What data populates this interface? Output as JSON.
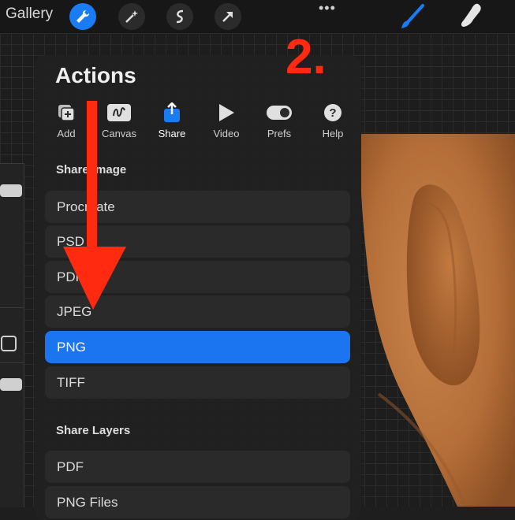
{
  "toolbar": {
    "gallery_label": "Gallery",
    "tools": [
      "wrench-icon",
      "magic-wand-icon",
      "selection-icon",
      "transform-arrow-icon"
    ],
    "more_label": "•••",
    "right_tools": [
      "brush-icon",
      "smudge-icon"
    ],
    "accent": "#1a7cf5"
  },
  "annotation": {
    "step_label": "2.",
    "arrow_color": "#ff2a10"
  },
  "actions_panel": {
    "title": "Actions",
    "tabs": [
      {
        "label": "Add",
        "icon": "add-image-icon"
      },
      {
        "label": "Canvas",
        "icon": "canvas-icon"
      },
      {
        "label": "Share",
        "icon": "share-icon",
        "selected": true
      },
      {
        "label": "Video",
        "icon": "play-icon"
      },
      {
        "label": "Prefs",
        "icon": "toggle-icon"
      },
      {
        "label": "Help",
        "icon": "help-icon"
      }
    ],
    "share_image": {
      "heading": "Share Image",
      "items": [
        "Procreate",
        "PSD",
        "PDF",
        "JPEG",
        "PNG",
        "TIFF"
      ],
      "selected": "PNG"
    },
    "share_layers": {
      "heading": "Share Layers",
      "items": [
        "PDF",
        "PNG Files"
      ]
    }
  }
}
